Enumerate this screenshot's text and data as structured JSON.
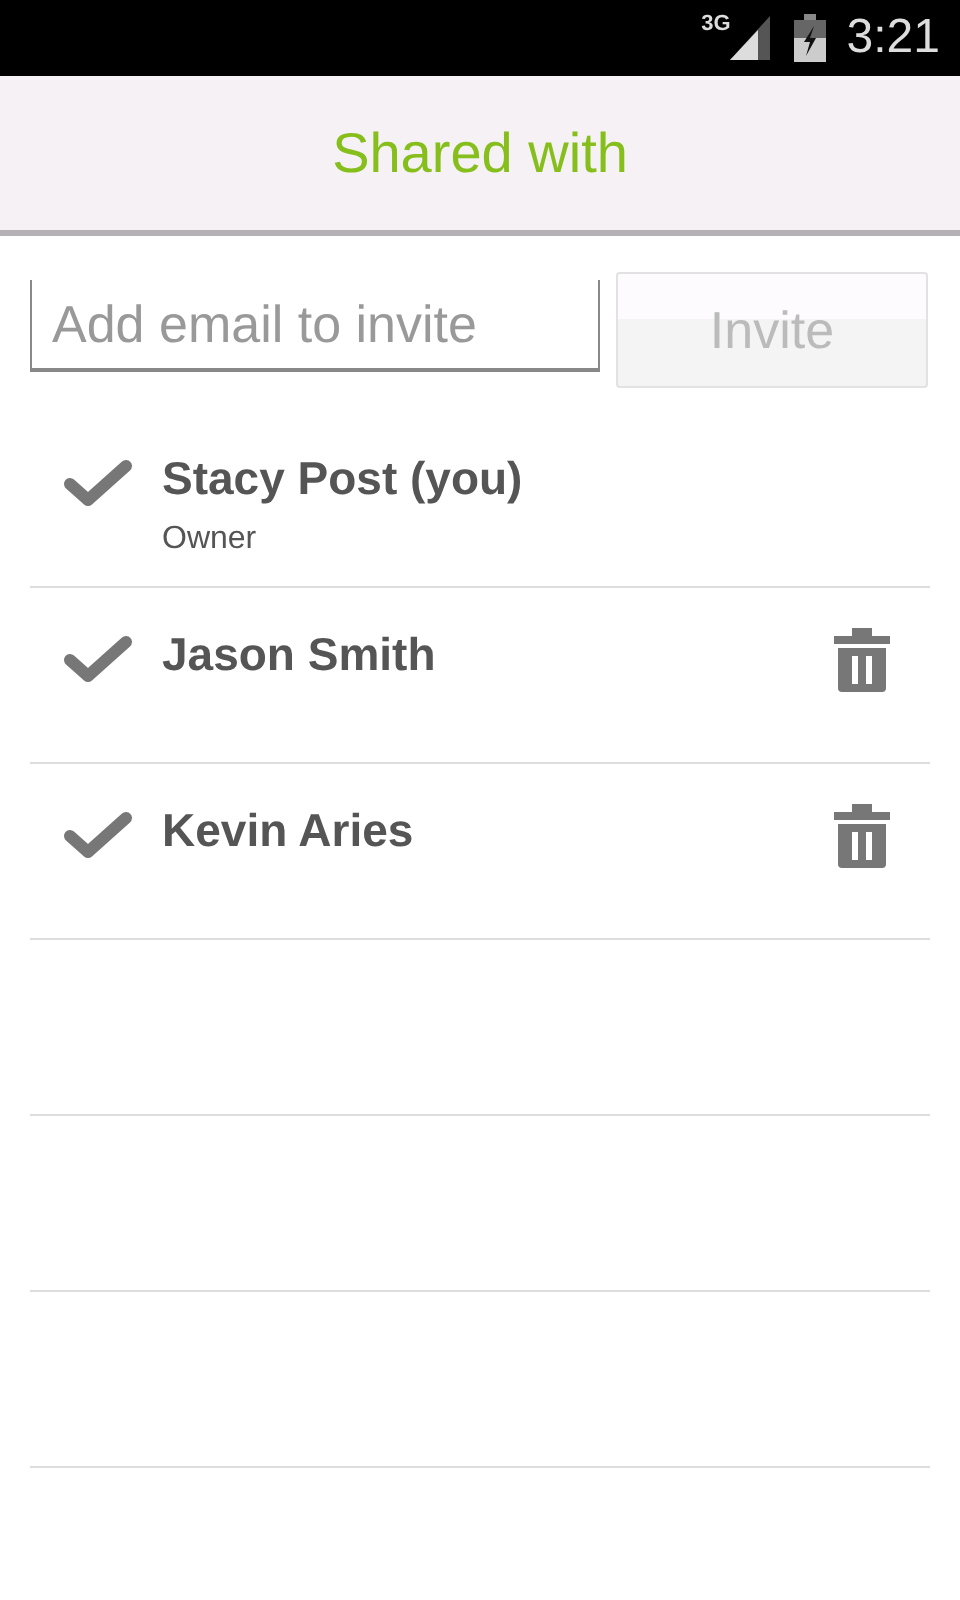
{
  "status_bar": {
    "network": "3G",
    "time": "3:21"
  },
  "title": "Shared with",
  "invite": {
    "placeholder": "Add email to invite",
    "button": "Invite",
    "button_disabled": true
  },
  "people": [
    {
      "name": "Stacy Post (you)",
      "role": "Owner",
      "removable": false
    },
    {
      "name": "Jason Smith",
      "removable": true
    },
    {
      "name": "Kevin Aries",
      "removable": true
    }
  ]
}
